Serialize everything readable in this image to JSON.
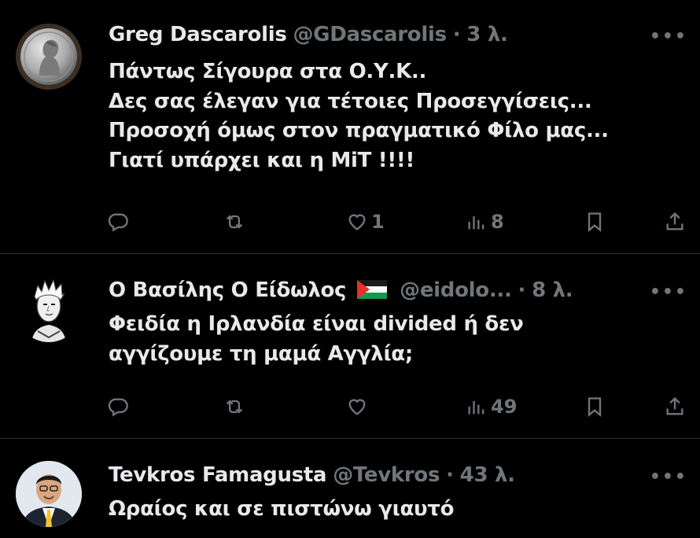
{
  "colors": {
    "background": "#000000",
    "text": "#e7e9ea",
    "muted": "#71767b",
    "divider": "#2f3336"
  },
  "tweets": [
    {
      "name": "Greg Dascarolis",
      "handle": "@GDascarolis",
      "separator": "·",
      "time": "3 λ.",
      "lines": [
        "Πάντως Σίγουρα στα Ο.Υ.Κ..",
        "Δες σας έλεγαν για τέτοιες Προσεγγίσεις...",
        "Προσοχή όμως στον πραγματικό Φίλο μας...",
        "Γιατί υπάρχει και η ΜiΤ !!!!"
      ],
      "likes": "1",
      "views": "8",
      "avatar": "coin-avatar"
    },
    {
      "name": "Ο Βασίλης Ο Είδωλος",
      "flag_icon": "palestine-flag-icon",
      "handle": "@eidolo...",
      "separator": "·",
      "time": "8 λ.",
      "lines": [
        "Φειδία η Ιρλανδία είναι divided ή δεν",
        "αγγίζουμε τη μαμά Αγγλία;"
      ],
      "likes": "",
      "views": "49",
      "avatar": "sketch-portrait-avatar"
    },
    {
      "name": "Tevkros Famagusta",
      "handle": "@Tevkros",
      "separator": "·",
      "time": "43 λ.",
      "lines": [
        "Ωραίος και σε πιστώνω γιαυτό"
      ],
      "avatar": "man-in-suit-avatar"
    }
  ],
  "more_label": "•••",
  "icons": [
    "reply-icon",
    "retweet-icon",
    "like-icon",
    "views-icon",
    "bookmark-icon",
    "share-icon",
    "more-icon"
  ]
}
